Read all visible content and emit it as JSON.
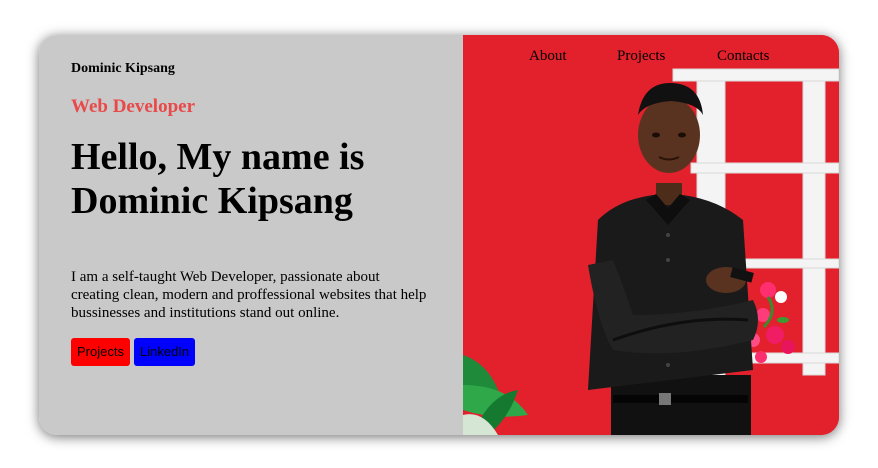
{
  "brand": {
    "name": "Dominic Kipsang"
  },
  "hero": {
    "role": "Web Developer",
    "headline_line1": "Hello, My name is",
    "headline_line2": "Dominic Kipsang",
    "bio": "I am a self-taught Web Developer, passionate about creating clean, modern and proffessional websites that help bussinesses and institutions stand out online."
  },
  "buttons": {
    "projects": "Projects",
    "linkedin": "LinkedIn"
  },
  "nav": {
    "about": "About",
    "projects": "Projects",
    "contacts": "Contacts"
  },
  "colors": {
    "left_panel": "#c9c9c9",
    "accent_role": "#e84a4a",
    "projects_button": "#ff0000",
    "linkedin_button": "#0000ff",
    "photo_background": "#e8232f"
  }
}
